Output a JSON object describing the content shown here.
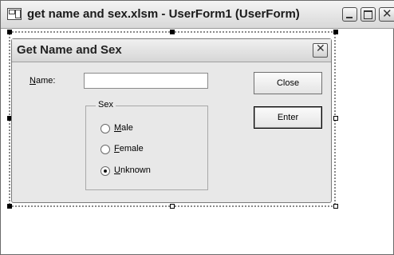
{
  "window": {
    "title": "get name and sex.xlsm - UserForm1 (UserForm)",
    "icon": "userform-icon",
    "controls": {
      "minimize": "minimize-icon",
      "maximize": "maximize-icon",
      "close": "✕"
    }
  },
  "userform": {
    "caption": "Get Name and Sex",
    "close_glyph": "✕",
    "name_label_first": "N",
    "name_label_rest": "ame:",
    "name_value": "",
    "buttons": {
      "close": "Close",
      "enter": "Enter"
    },
    "sex_group": {
      "caption": "Sex",
      "options": [
        {
          "accel": "M",
          "rest": "ale",
          "checked": false
        },
        {
          "accel": "F",
          "rest": "emale",
          "checked": false
        },
        {
          "accel": "U",
          "rest": "nknown",
          "checked": true
        }
      ]
    }
  }
}
